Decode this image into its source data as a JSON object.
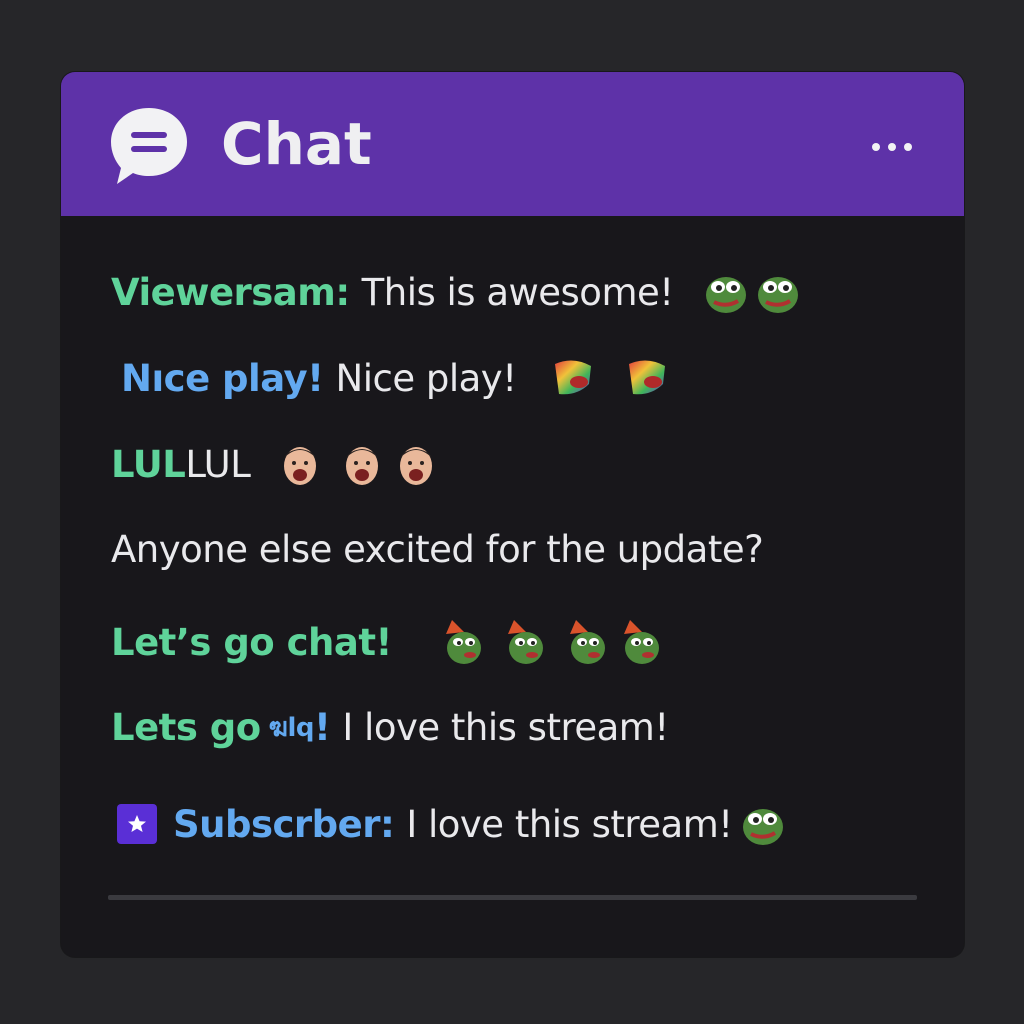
{
  "header": {
    "title": "Chat",
    "icon": "chat-bubble-icon",
    "more_icon": "more-horizontal-icon"
  },
  "colors": {
    "header_bg": "#5e32a8",
    "panel_bg": "#18171b",
    "page_bg": "#262629",
    "green_user": "#5fd39a",
    "blue_user": "#63a9f0",
    "text": "#e9e9ec",
    "sub_badge": "#5a2fd6"
  },
  "messages": [
    {
      "user": "Viewersam:",
      "user_color": "#5fd39a",
      "text": "This is awesome!",
      "emotes": [
        "pepe-frog-icon",
        "pepe-frog-icon"
      ]
    },
    {
      "user": "Nıce play!",
      "user_color": "#63a9f0",
      "text": "Nice play!",
      "emotes": [
        "rainbow-pogchamp-icon",
        "rainbow-pogchamp-icon"
      ]
    },
    {
      "user_part": "LUL",
      "user_color": "#5fd39a",
      "text": "LUL",
      "emotes": [
        "laughing-face-icon",
        "laughing-face-icon",
        "laughing-face-icon"
      ]
    },
    {
      "text": "Anyone else excited for the update?"
    },
    {
      "user": "Let’s go chat!",
      "user_color": "#5fd39a",
      "emotes": [
        "party-frog-icon",
        "party-frog-icon",
        "party-frog-icon",
        "party-frog-icon"
      ]
    },
    {
      "user": "Lets go",
      "user_color": "#5fd39a",
      "garbled": "ฆlq",
      "garbled_color": "#63a9f0",
      "bang": "!",
      "text": "I love this stream!"
    },
    {
      "badge": "subscriber-star-icon",
      "user": "Subscrber:",
      "user_color": "#63a9f0",
      "text": "I love this stream!",
      "emotes": [
        "pepe-frog-icon"
      ]
    }
  ]
}
